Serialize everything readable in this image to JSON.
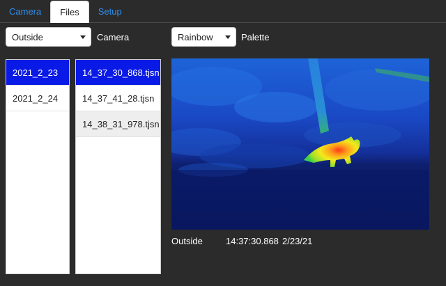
{
  "tabs": [
    {
      "label": "Camera",
      "active": false
    },
    {
      "label": "Files",
      "active": true
    },
    {
      "label": "Setup",
      "active": false
    }
  ],
  "camera_select": {
    "value": "Outside",
    "label": "Camera"
  },
  "palette_select": {
    "value": "Rainbow",
    "label": "Palette"
  },
  "dates": {
    "items": [
      "2021_2_23",
      "2021_2_24"
    ],
    "selected": 0
  },
  "files": {
    "items": [
      "14_37_30_868.tjsn",
      "14_37_41_28.tjsn",
      "14_38_31_978.tjsn"
    ],
    "selected": 0,
    "hovered": 2
  },
  "image_info": {
    "camera": "Outside",
    "time": "14:37:30.868",
    "date": "2/23/21"
  },
  "colors": {
    "accent": "#2f8ff0",
    "selection": "#0a1ae6",
    "background": "#2b2b2b"
  }
}
